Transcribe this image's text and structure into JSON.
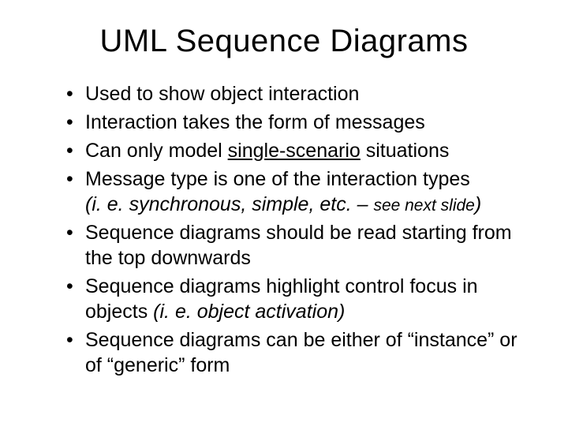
{
  "title": "UML Sequence Diagrams",
  "bullets": [
    {
      "text": "Used to show object interaction"
    },
    {
      "text": "Interaction takes the form of messages"
    },
    {
      "pre": "Can only model ",
      "u": "single-scenario",
      "post": " situations"
    },
    {
      "line1": "Message type is one of the interaction types",
      "em_pre": "(i. e.  synchronous, simple, etc. – ",
      "em_small": "see next slide",
      "em_post": ")"
    },
    {
      "text": "Sequence diagrams should be read starting from the top downwards"
    },
    {
      "line1": "Sequence diagrams highlight control focus in objects ",
      "em": "(i. e. object activation)"
    },
    {
      "text": "Sequence diagrams can be either of “instance” or of “generic” form"
    }
  ]
}
